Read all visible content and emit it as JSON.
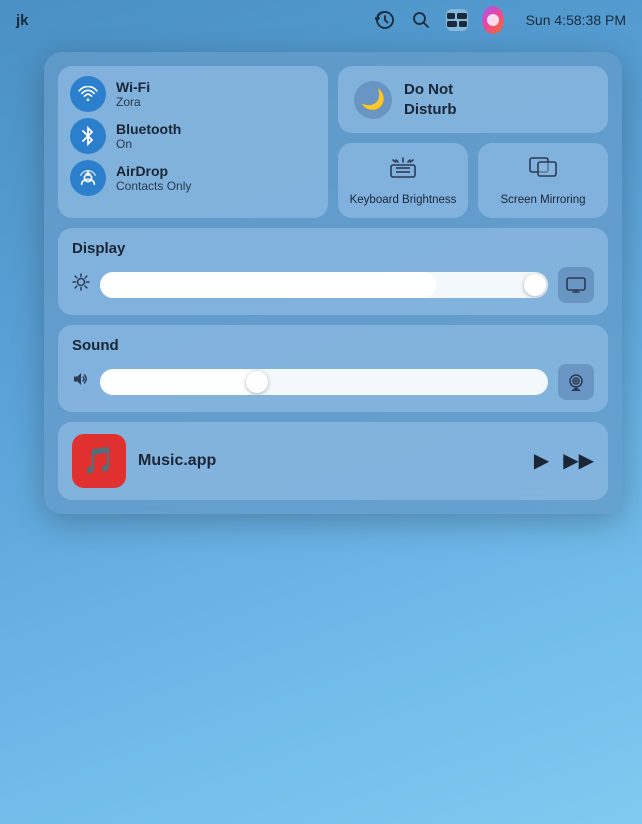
{
  "menubar": {
    "user_initials": "jk",
    "time": "Sun 4:58:38 PM"
  },
  "network": {
    "wifi_label": "Wi-Fi",
    "wifi_sub": "Zora",
    "bluetooth_label": "Bluetooth",
    "bluetooth_sub": "On",
    "airdrop_label": "AirDrop",
    "airdrop_sub": "Contacts Only"
  },
  "dnd": {
    "label": "Do Not\nDisturb"
  },
  "keyboard": {
    "label": "Keyboard\nBrightness"
  },
  "mirroring": {
    "label": "Screen\nMirroring"
  },
  "display": {
    "title": "Display",
    "brightness_pct": 75
  },
  "sound": {
    "title": "Sound",
    "volume_pct": 35
  },
  "music": {
    "app_name": "Music.app"
  }
}
